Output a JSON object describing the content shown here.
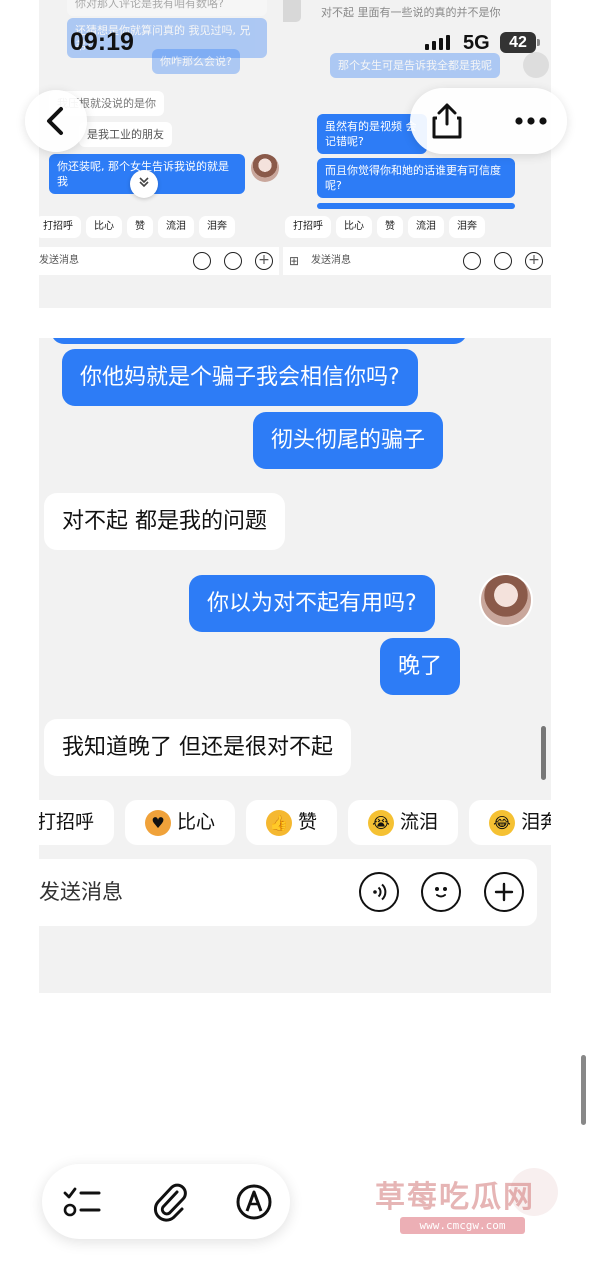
{
  "status": {
    "time": "09:19",
    "network": "5G",
    "battery": "42"
  },
  "shot1": {
    "left_col": {
      "faded_top": [
        "你对那人评论是我有咱有数咯?",
        "还猜想是你就算问真的 我见过吗, 兄弟?",
        "你咋那么会说?",
        "我压根就没说的是你",
        "是我工业的朋友"
      ],
      "bubble": "你还装呢, 那个女生告诉我说的就是我",
      "chips": [
        "打招呼",
        "比心",
        "赞",
        "流泪",
        "泪奔"
      ],
      "input_placeholder": "发送消息"
    },
    "right_col": {
      "faded_top": [
        "对不起 里面有一些说的真的并不是你",
        "那个女生可是告诉我全都是我呢"
      ],
      "bubble_a": "虽然有的是视频 会记错呢?",
      "bubble_b": "而且你觉得你和她的话谁更有可信度呢?",
      "chips": [
        "打招呼",
        "比心",
        "赞",
        "流泪",
        "泪奔"
      ],
      "input_placeholder": "发送消息"
    }
  },
  "chat": {
    "messages": [
      {
        "dir": "out",
        "text": "你他妈就是个骗子我会相信你吗?"
      },
      {
        "dir": "out",
        "text": "彻头彻尾的骗子"
      },
      {
        "dir": "in",
        "text": "对不起 都是我的问题"
      },
      {
        "dir": "out",
        "text": "你以为对不起有用吗?"
      },
      {
        "dir": "out",
        "text": "晚了"
      },
      {
        "dir": "in",
        "text": "我知道晚了 但还是很对不起"
      }
    ],
    "quick_replies": [
      "打招呼",
      "比心",
      "赞",
      "流泪",
      "泪奔"
    ],
    "input_placeholder": "发送消息"
  },
  "watermark": {
    "title": "草莓吃瓜网",
    "url": "www.cmcgw.com"
  },
  "colors": {
    "outgoing": "#2d7cf6",
    "incoming": "#ffffff",
    "chat_bg": "#f2f2f2"
  }
}
